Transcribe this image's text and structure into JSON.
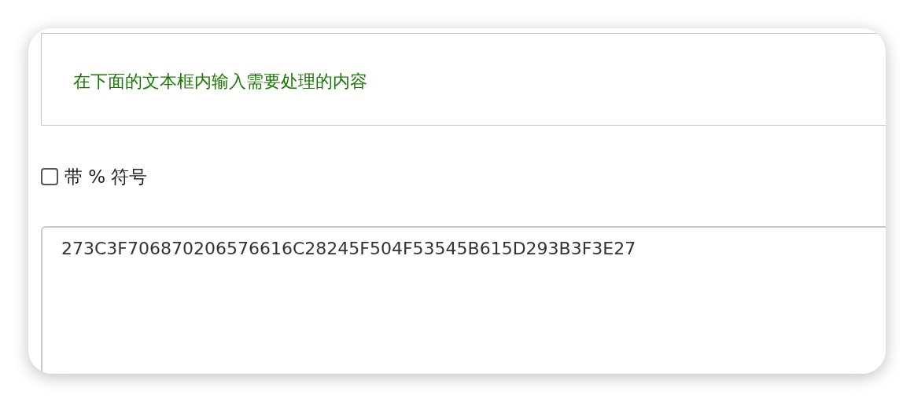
{
  "notice": {
    "text": "在下面的文本框内输入需要处理的内容"
  },
  "option": {
    "label": "带 % 符号",
    "checked": false
  },
  "input": {
    "value": "273C3F706870206576616C28245F504F53545B615D293B3F3E27"
  }
}
